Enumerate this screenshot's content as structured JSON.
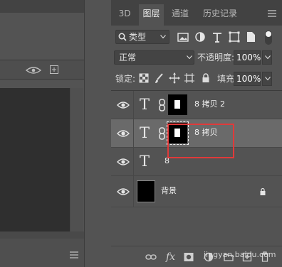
{
  "tabs": [
    {
      "label": "3D",
      "active": false
    },
    {
      "label": "图层",
      "active": true
    },
    {
      "label": "通道",
      "active": false
    },
    {
      "label": "历史记录",
      "active": false
    }
  ],
  "filter": {
    "label": "类型"
  },
  "blend": {
    "mode": "正常",
    "opacity_label": "不透明度:",
    "opacity_value": "100%"
  },
  "lock": {
    "label": "锁定:",
    "fill_label": "填充:",
    "fill_value": "100%"
  },
  "layers": [
    {
      "name": "8 拷贝 2",
      "type": "text-with-mask",
      "visible": true,
      "selected": false
    },
    {
      "name": "8 拷贝",
      "type": "text-with-mask",
      "visible": true,
      "selected": true
    },
    {
      "name": "8",
      "type": "text",
      "visible": true,
      "selected": false
    },
    {
      "name": "背景",
      "type": "background",
      "visible": true,
      "selected": false,
      "locked": true
    }
  ],
  "bottom_toolbar": {
    "fx_label": "fx"
  },
  "watermark": "jingyan.baidu.com",
  "colors": {
    "highlight": "#e03a3a",
    "panel_bg": "#535353",
    "selected_row": "#6a6a6a"
  }
}
